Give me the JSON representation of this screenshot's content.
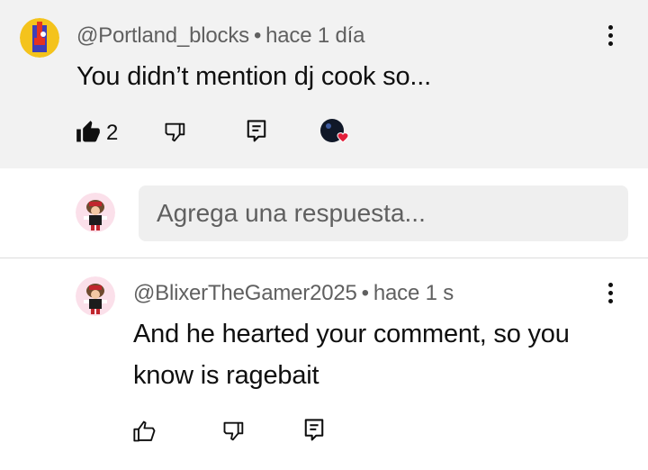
{
  "comment": {
    "author": "@Portland_blocks",
    "separator": "•",
    "time": "hace 1 día",
    "text": "You didn’t mention dj cook so...",
    "like_count": "2",
    "hearted": true
  },
  "reply_input": {
    "placeholder": "Agrega una respuesta..."
  },
  "reply": {
    "author": "@BlixerTheGamer2025",
    "separator": "•",
    "time": "hace 1 s",
    "text": "And he hearted your comment, so you know is ragebait"
  },
  "icons": {
    "like_filled": "thumbs-up-filled-icon",
    "like_outline": "thumbs-up-icon",
    "dislike": "thumbs-down-icon",
    "reply": "reply-icon",
    "more": "more-vert-icon",
    "heart": "creator-heart-icon"
  },
  "colors": {
    "heart": "#e21f3b",
    "top_comment_bg": "#f2f2f2",
    "secondary_text": "#606060"
  }
}
